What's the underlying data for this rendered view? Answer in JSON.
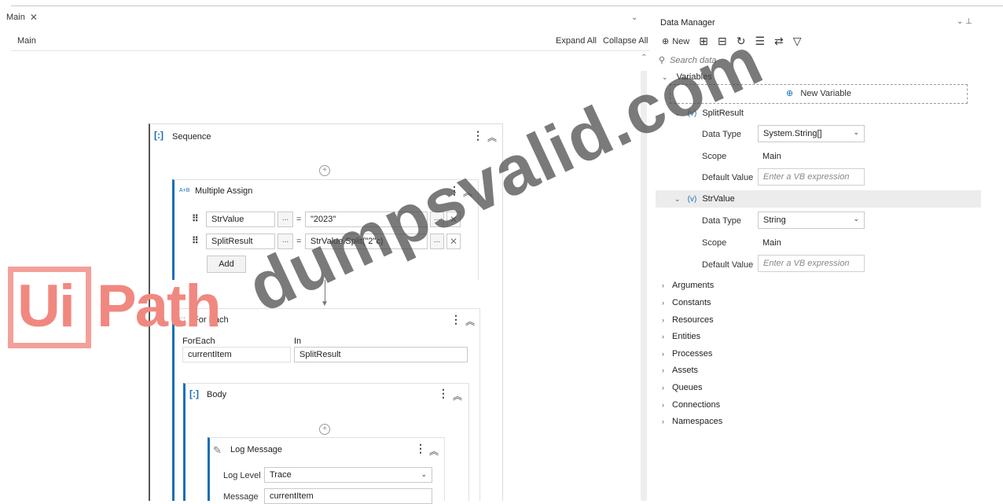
{
  "designer": {
    "tab_label": "Main",
    "breadcrumb": "Main",
    "expand_all": "Expand All",
    "collapse_all": "Collapse All"
  },
  "sequence": {
    "title": "Sequence"
  },
  "multiple_assign": {
    "title": "Multiple Assign",
    "rows": [
      {
        "to": "StrValue",
        "eq": "=",
        "value": "\"2023\""
      },
      {
        "to": "SplitResult",
        "eq": "=",
        "value": "StrValue.Split(\"2\"c)"
      }
    ],
    "ellipsis": "...",
    "add_label": "Add"
  },
  "for_each": {
    "title": "For Each",
    "foreach_label": "ForEach",
    "in_label": "In",
    "item": "currentItem",
    "collection": "SplitResult"
  },
  "body": {
    "title": "Body"
  },
  "log_message": {
    "title": "Log Message",
    "level_label": "Log Level",
    "level_value": "Trace",
    "message_label": "Message",
    "message_value": "currentItem"
  },
  "logo": {
    "ui": "Ui",
    "path": "Path"
  },
  "watermark": "dumpsvalid.com",
  "data_manager": {
    "title": "Data Manager",
    "new_label": "New",
    "search_placeholder": "Search data",
    "variables_label": "Variables",
    "new_variable_label": "New Variable",
    "variables": [
      {
        "name": "SplitResult",
        "data_type_label": "Data Type",
        "data_type": "System.String[]",
        "scope_label": "Scope",
        "scope": "Main",
        "default_label": "Default Value",
        "default_placeholder": "Enter a VB expression"
      },
      {
        "name": "StrValue",
        "data_type_label": "Data Type",
        "data_type": "String",
        "scope_label": "Scope",
        "scope": "Main",
        "default_label": "Default Value",
        "default_placeholder": "Enter a VB expression"
      }
    ],
    "sections": [
      "Arguments",
      "Constants",
      "Resources",
      "Entities",
      "Processes",
      "Assets",
      "Queues",
      "Connections",
      "Namespaces"
    ]
  },
  "colors": {
    "accent": "#1a6fb5",
    "logo": "#f08880",
    "watermark": "#464646"
  }
}
